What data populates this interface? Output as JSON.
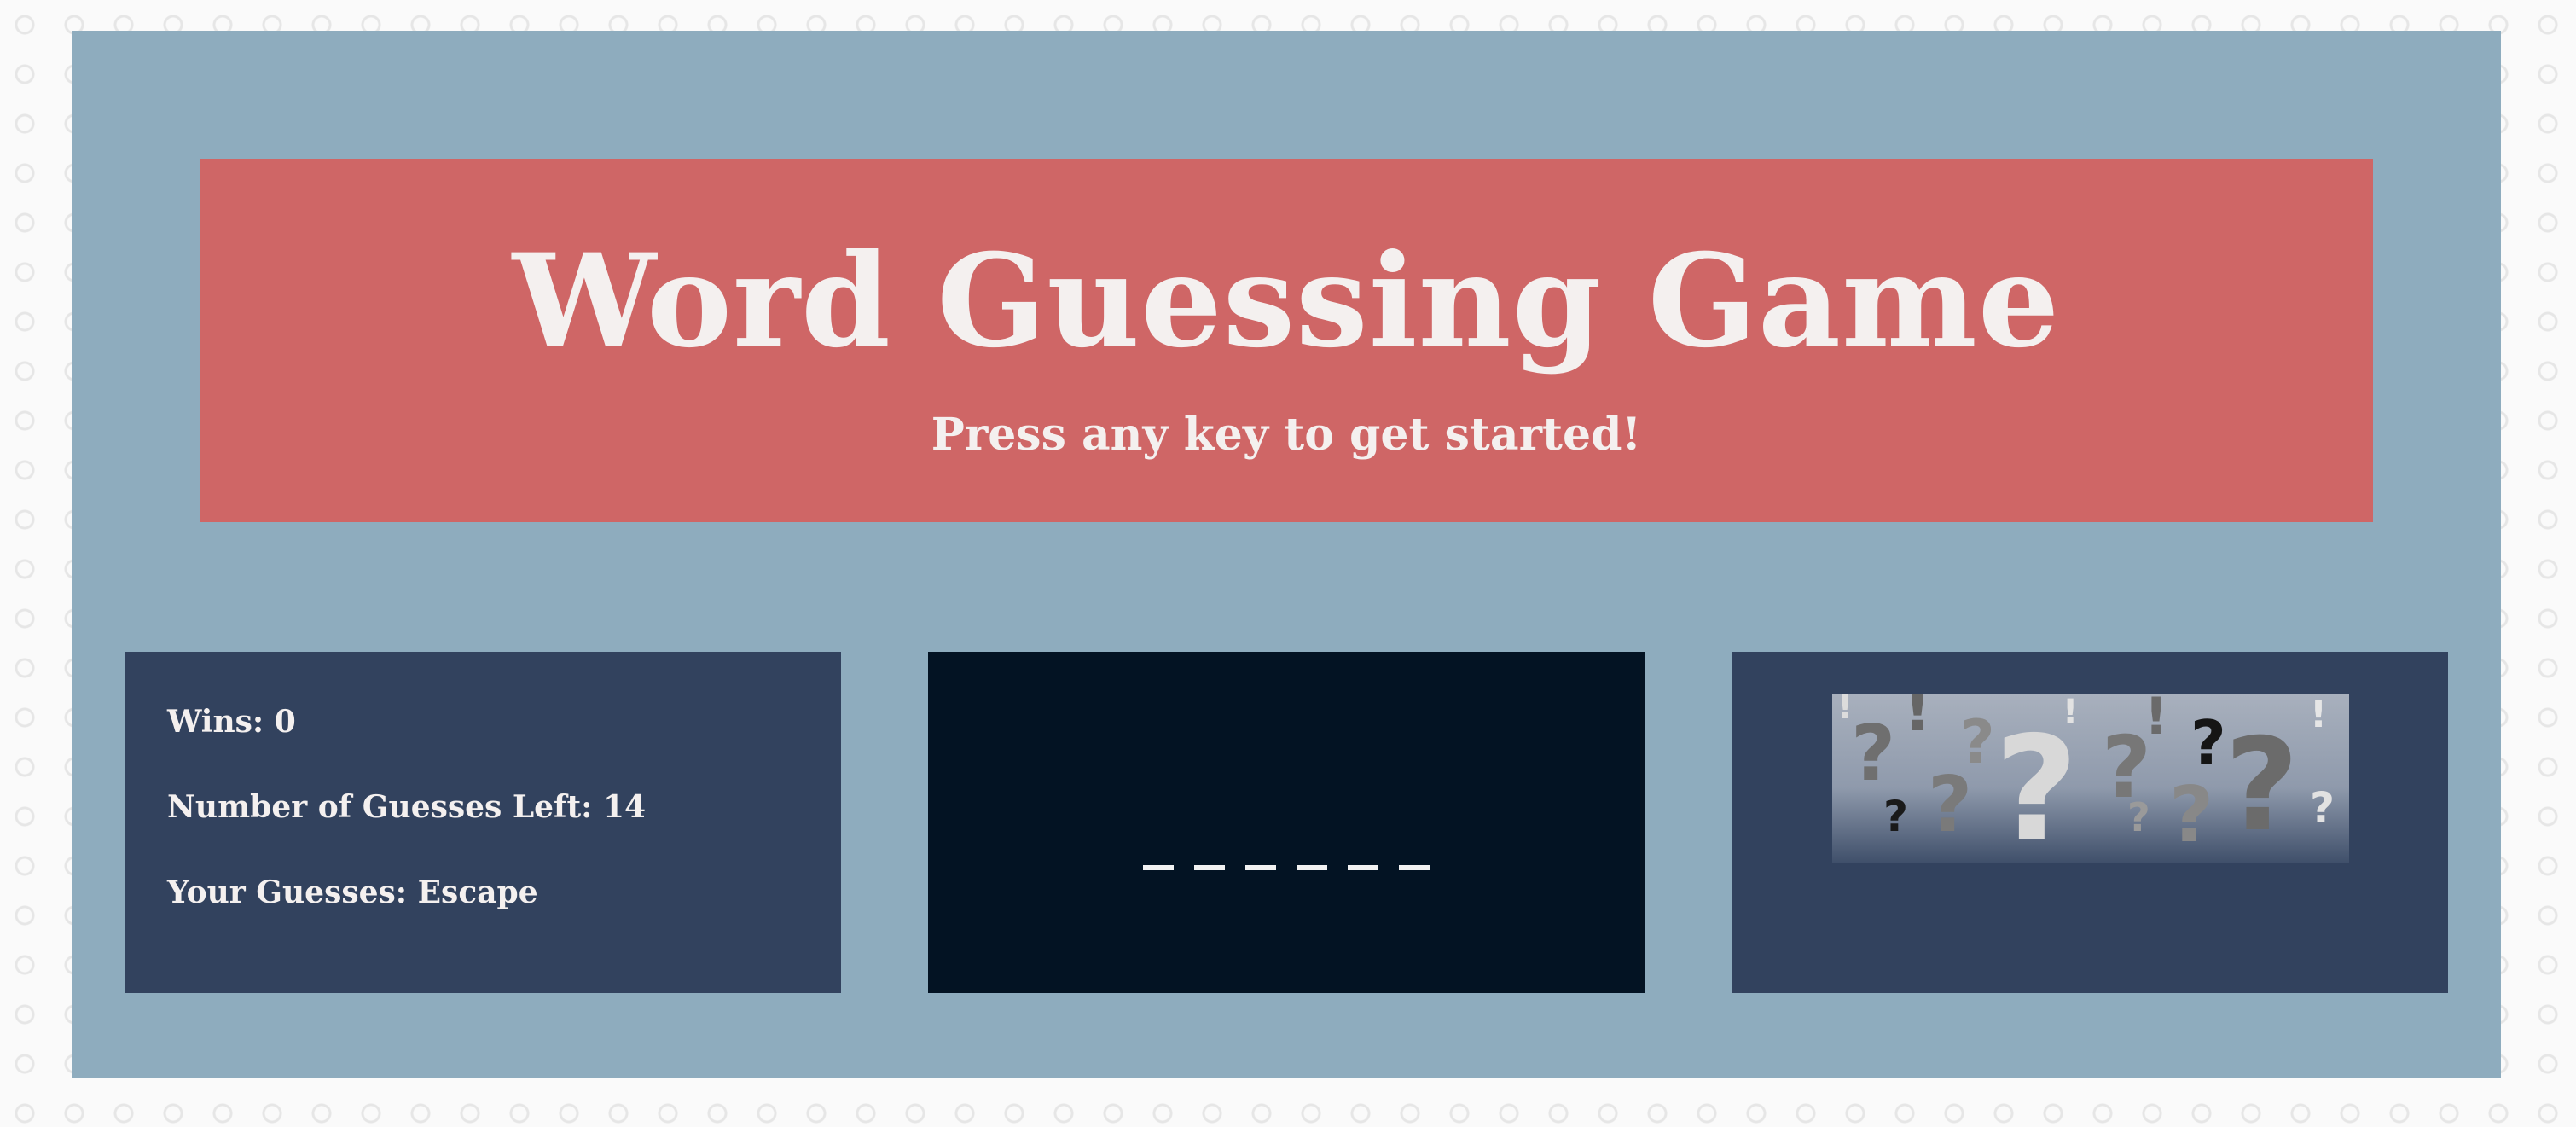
{
  "header": {
    "title": "Word Guessing Game",
    "subtitle": "Press any key to get started!"
  },
  "stats": {
    "wins": "Wins: 0",
    "guesses_left": "Number of Guesses Left: 14",
    "your_guesses": "Your Guesses: Escape"
  },
  "word": {
    "blanks": [
      "_",
      "_",
      "_",
      "_",
      "_",
      "_"
    ]
  },
  "art": {
    "icon": "question-marks-image"
  },
  "colors": {
    "page_bg": "#fafafa",
    "main_bg": "#8eacbe",
    "header_bg": "#cf6666",
    "panel_bg": "#32425e",
    "word_panel_bg": "#031323",
    "text": "#f4f0ef"
  }
}
